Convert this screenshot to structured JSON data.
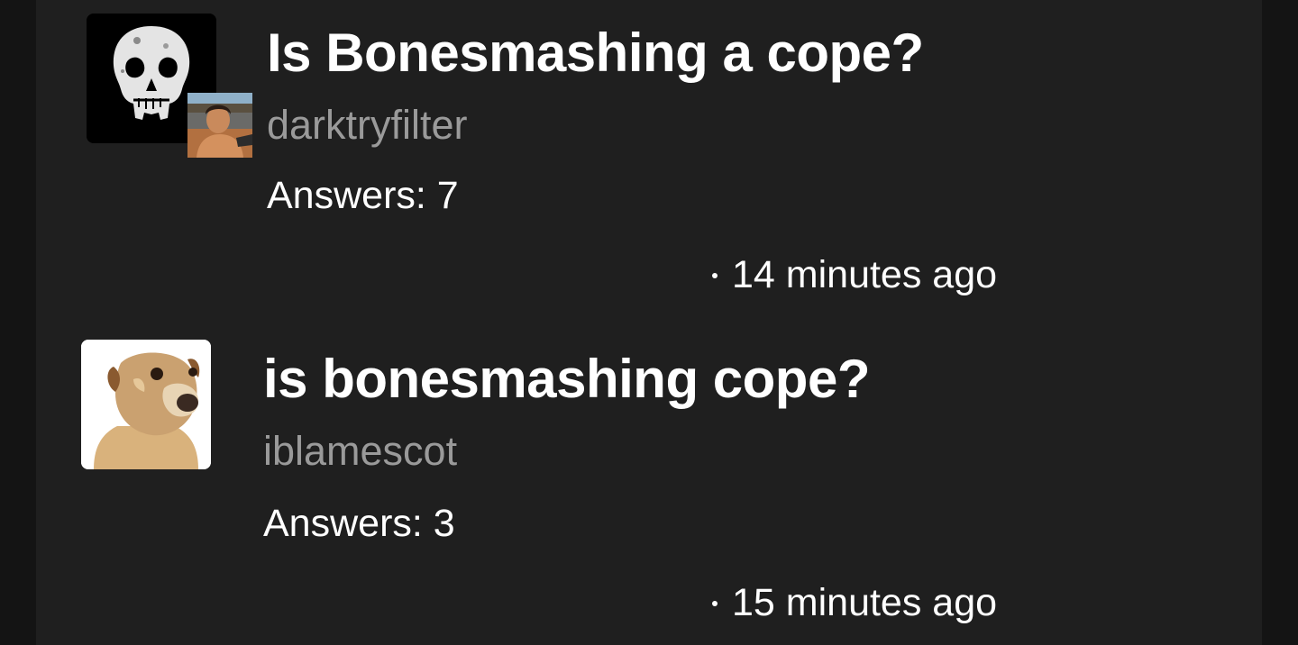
{
  "posts": [
    {
      "title": "Is Bonesmashing a cope?",
      "author": "darktryfilter",
      "answers_label": "Answers: 7",
      "time_ago": "14 minutes ago",
      "avatar_icon": "skull-icon",
      "has_secondary_avatar": true
    },
    {
      "title": "is bonesmashing cope?",
      "author": "iblamescot",
      "answers_label": "Answers: 3",
      "time_ago": "15 minutes ago",
      "avatar_icon": "dog-icon",
      "has_secondary_avatar": false
    }
  ],
  "colors": {
    "background": "#1f1f1f",
    "gutter": "#141414",
    "title": "#ffffff",
    "author": "#9a9a9a"
  }
}
